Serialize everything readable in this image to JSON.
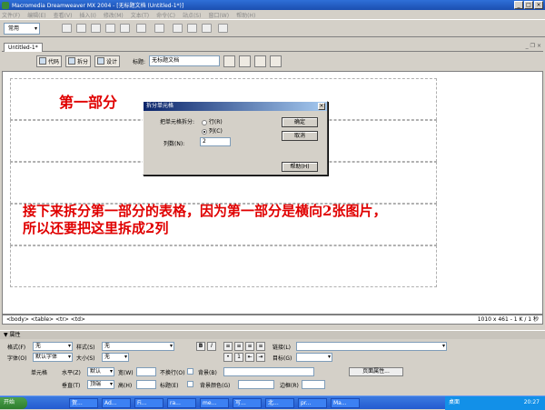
{
  "window": {
    "title": "Macromedia Dreamweaver MX 2004 - [无标题文档 (Untitled-1*)]"
  },
  "menu": [
    "文件(F)",
    "编辑(E)",
    "查看(V)",
    "插入(I)",
    "修改(M)",
    "文本(T)",
    "命令(C)",
    "站点(S)",
    "窗口(W)",
    "帮助(H)"
  ],
  "insertbar": {
    "category": "常用"
  },
  "document": {
    "tab": "Untitled-1*",
    "views": {
      "code": "代码",
      "split": "拆分",
      "design": "设计"
    },
    "title_label": "标题:",
    "title_value": "无标题文档"
  },
  "annotations": {
    "part1": "第一部分",
    "line1": "接下来拆分第一部分的表格，因为第一部分是横向2张图片，",
    "line2": "所以还要把这里拆成2列"
  },
  "dialog": {
    "title": "拆分单元格",
    "split_label": "把单元格拆分:",
    "row_option": "行(R)",
    "col_option": "列(C)",
    "selected": "列(C)",
    "count_label": "列数(N):",
    "count_value": "2",
    "ok": "确定",
    "cancel": "取消",
    "help": "帮助(H)"
  },
  "statusbar": {
    "tags": "<body> <table> <tr> <td>",
    "size": "1010 x 461 - 1 K / 1 秒"
  },
  "properties": {
    "panel_title": "▼ 属性",
    "format_label": "格式(F)",
    "format_value": "无",
    "style_label": "样式(S)",
    "style_value": "无",
    "font_label": "字体(O)",
    "font_value": "默认字体",
    "size_label": "大小(S)",
    "size_value": "无",
    "link_label": "链接(L)",
    "target_label": "目标(G)",
    "cell_label": "单元格",
    "halign_label": "水平(Z)",
    "halign_value": "默认",
    "width_label": "宽(W)",
    "nowrap_label": "不换行(O)",
    "bg_label": "背景(B)",
    "valign_label": "垂直(T)",
    "valign_value": "顶端",
    "height_label": "高(H)",
    "header_label": "标题(E)",
    "bgcolor_label": "背景颜色(G)",
    "border_label": "边框(R)",
    "page_props": "页面属性..."
  },
  "taskbar": {
    "start": "开始",
    "tasks": [
      "贺...",
      "Ad...",
      "Fi...",
      "ra...",
      "me...",
      "写...",
      "北...",
      "pr...",
      "Ma..."
    ],
    "desktop": "桌面",
    "clock": "20:27"
  }
}
